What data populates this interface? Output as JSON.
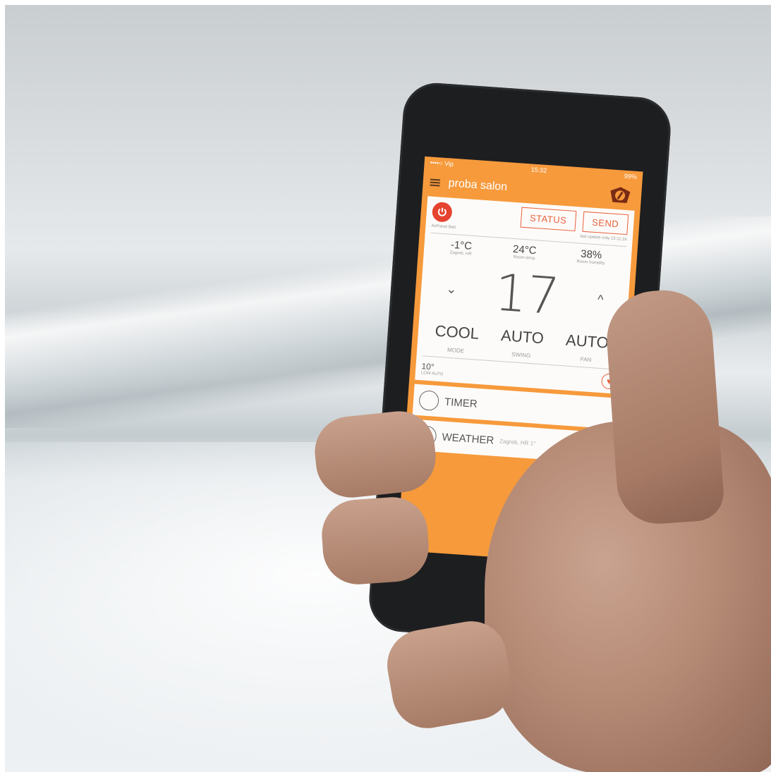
{
  "status_bar": {
    "carrier": "••••○ Vip",
    "time": "15:32",
    "battery": "99%"
  },
  "app_bar": {
    "title": "proba salon"
  },
  "controls": {
    "device_name": "AirPanel Belt",
    "status_label": "STATUS",
    "send_label": "SEND",
    "last_update": "last update only 15:11:16"
  },
  "readings": [
    {
      "value": "-1°C",
      "label": "Zagreb, HR"
    },
    {
      "value": "24°C",
      "label": "Room temp"
    },
    {
      "value": "38%",
      "label": "Room humidity"
    }
  ],
  "setpoint": {
    "value": "17",
    "down": "⌄",
    "up": "^"
  },
  "modes": [
    {
      "value": "COOL",
      "label": "MODE"
    },
    {
      "value": "AUTO",
      "label": "SWING"
    },
    {
      "value": "AUTO",
      "label": "FAN"
    }
  ],
  "timer_mini": {
    "value": "10°",
    "label": "LOW AUTO"
  },
  "panels": {
    "timer_label": "TIMER",
    "weather_label": "WEATHER",
    "weather_sub": "Zagreb, HR 1°"
  },
  "colors": {
    "accent": "#f69a3c",
    "button": "#e8603c",
    "power": "#e5432f"
  }
}
